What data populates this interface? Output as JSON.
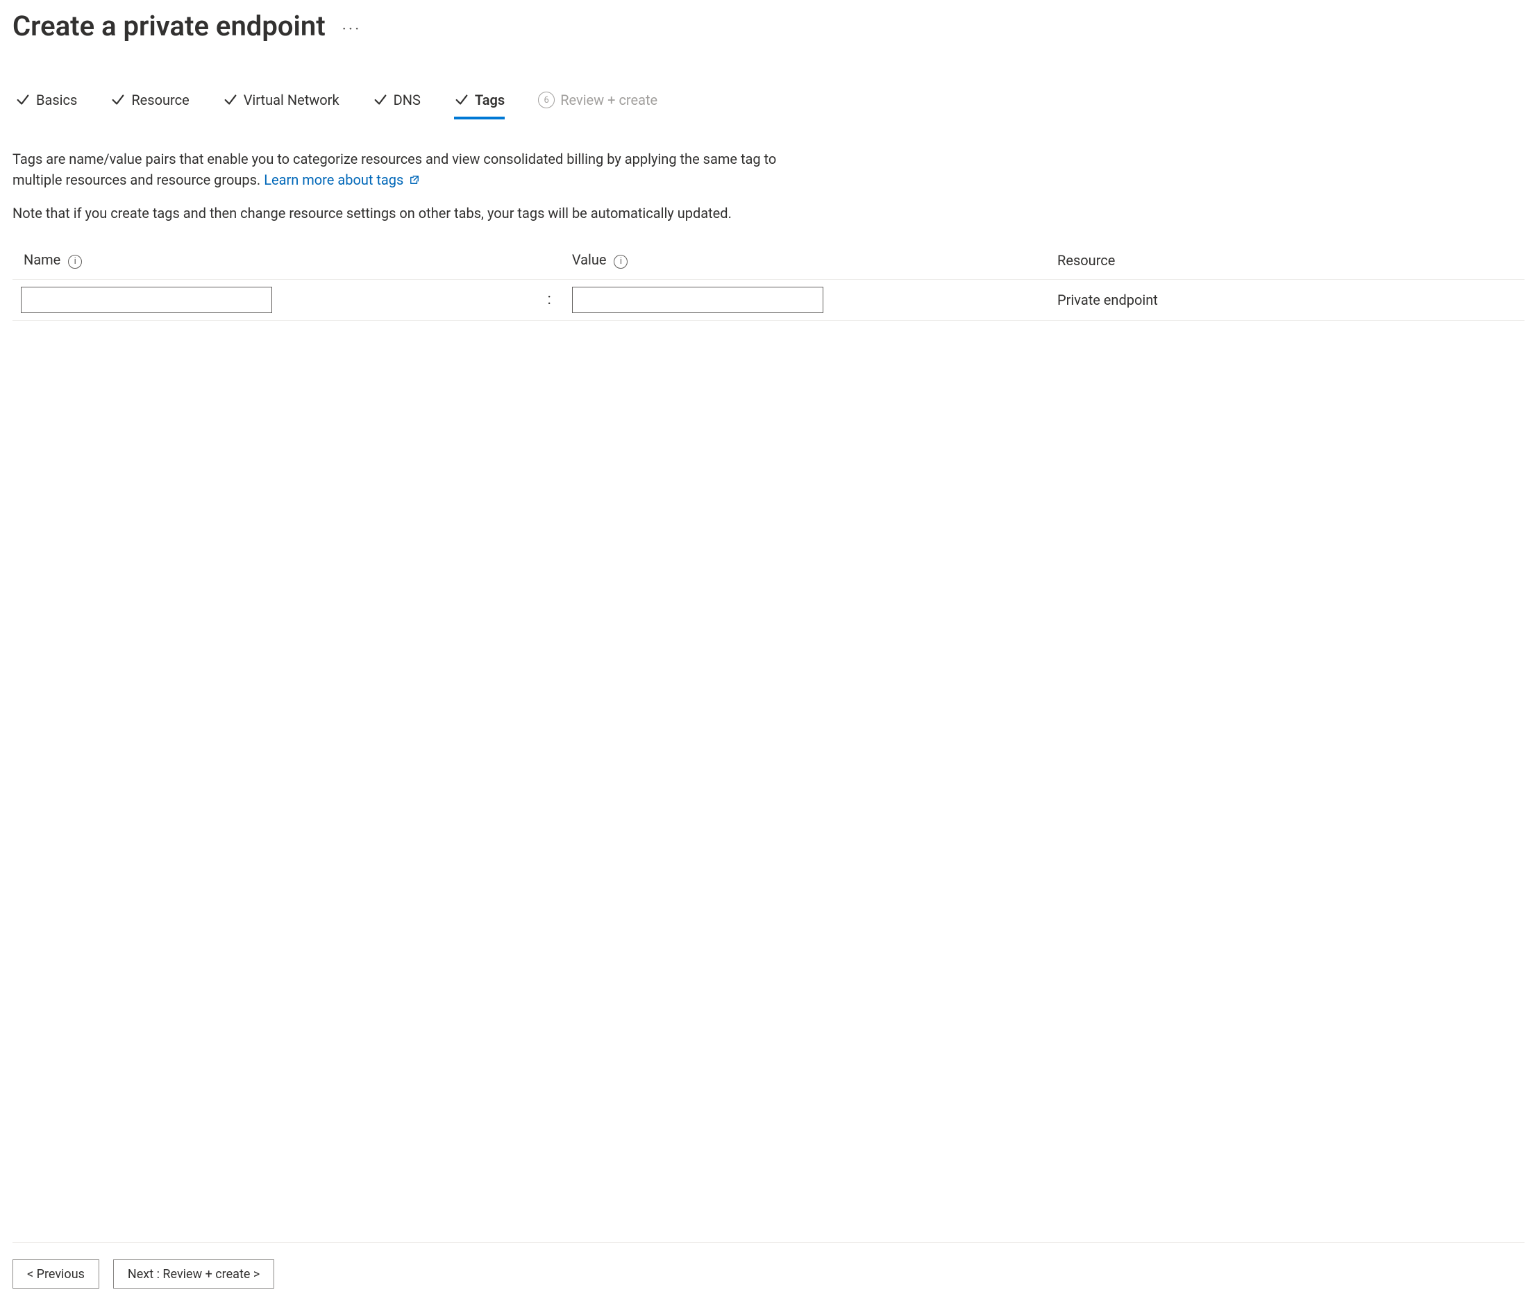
{
  "header": {
    "title": "Create a private endpoint"
  },
  "tabs": [
    {
      "label": "Basics",
      "state": "done"
    },
    {
      "label": "Resource",
      "state": "done"
    },
    {
      "label": "Virtual Network",
      "state": "done"
    },
    {
      "label": "DNS",
      "state": "done"
    },
    {
      "label": "Tags",
      "state": "active"
    },
    {
      "label": "Review + create",
      "state": "pending",
      "number": "6"
    }
  ],
  "body": {
    "description": "Tags are name/value pairs that enable you to categorize resources and view consolidated billing by applying the same tag to multiple resources and resource groups.",
    "learn_more": "Learn more about tags",
    "note": "Note that if you create tags and then change resource settings on other tabs, your tags will be automatically updated."
  },
  "table": {
    "headers": {
      "name": "Name",
      "value": "Value",
      "resource": "Resource"
    },
    "separator": ":",
    "row": {
      "name_value": "",
      "value_value": "",
      "resource": "Private endpoint"
    }
  },
  "footer": {
    "previous": "< Previous",
    "next": "Next : Review + create >"
  }
}
